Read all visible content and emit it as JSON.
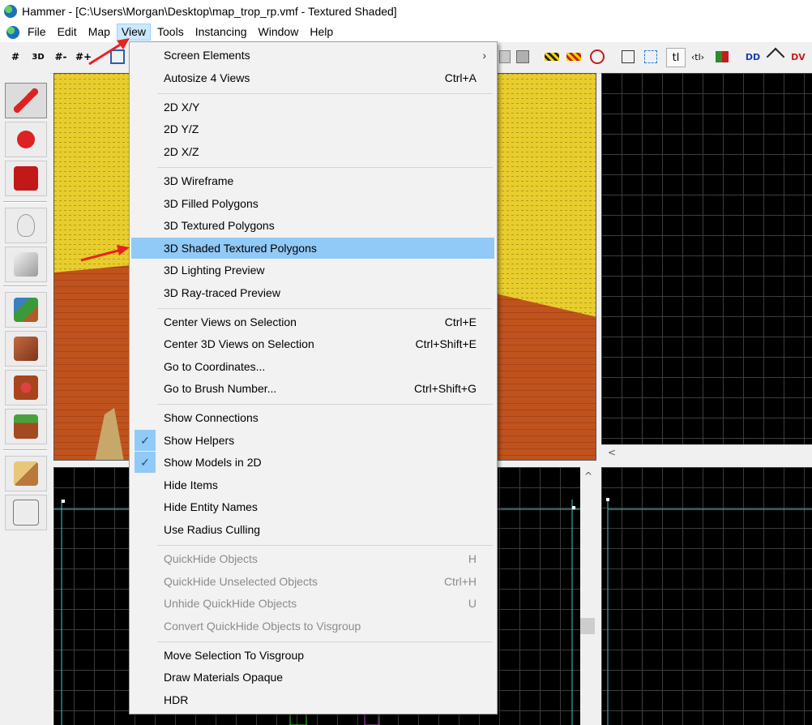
{
  "window": {
    "title": "Hammer - [C:\\Users\\Morgan\\Desktop\\map_trop_rp.vmf - Textured Shaded]"
  },
  "menubar": {
    "items": [
      "File",
      "Edit",
      "Map",
      "View",
      "Tools",
      "Instancing",
      "Window",
      "Help"
    ],
    "active": "View"
  },
  "toolbar": {
    "grid_label": "#",
    "grid3d_label": "3D",
    "grid_minus_label": "#-",
    "grid_plus_label": "#+",
    "texture_lock_label": "tl",
    "tl_arrows_label": "‹tl›",
    "dd_label": "DD",
    "dv_label": "DV"
  },
  "view_menu": {
    "items": [
      {
        "label": "Screen Elements",
        "shortcut": "",
        "submenu": true
      },
      {
        "label": "Autosize 4 Views",
        "shortcut": "Ctrl+A"
      },
      {
        "label": "2D X/Y",
        "shortcut": ""
      },
      {
        "label": "2D Y/Z",
        "shortcut": ""
      },
      {
        "label": "2D X/Z",
        "shortcut": ""
      },
      {
        "label": "3D Wireframe",
        "shortcut": ""
      },
      {
        "label": "3D Filled Polygons",
        "shortcut": ""
      },
      {
        "label": "3D Textured Polygons",
        "shortcut": ""
      },
      {
        "label": "3D Shaded Textured Polygons",
        "shortcut": "",
        "highlighted": true
      },
      {
        "label": "3D Lighting Preview",
        "shortcut": ""
      },
      {
        "label": "3D Ray-traced Preview",
        "shortcut": ""
      },
      {
        "label": "Center Views on Selection",
        "shortcut": "Ctrl+E"
      },
      {
        "label": "Center 3D Views on Selection",
        "shortcut": "Ctrl+Shift+E"
      },
      {
        "label": "Go to Coordinates...",
        "shortcut": ""
      },
      {
        "label": "Go to Brush Number...",
        "shortcut": "Ctrl+Shift+G"
      },
      {
        "label": "Show Connections",
        "shortcut": ""
      },
      {
        "label": "Show Helpers",
        "shortcut": "",
        "checked": true
      },
      {
        "label": "Show Models in 2D",
        "shortcut": "",
        "checked": true
      },
      {
        "label": "Hide Items",
        "shortcut": ""
      },
      {
        "label": "Hide Entity Names",
        "shortcut": ""
      },
      {
        "label": "Use Radius Culling",
        "shortcut": ""
      },
      {
        "label": "QuickHide Objects",
        "shortcut": "H",
        "disabled": true
      },
      {
        "label": "QuickHide Unselected Objects",
        "shortcut": "Ctrl+H",
        "disabled": true
      },
      {
        "label": "Unhide QuickHide Objects",
        "shortcut": "U",
        "disabled": true
      },
      {
        "label": "Convert QuickHide Objects to Visgroup",
        "shortcut": "",
        "disabled": true
      },
      {
        "label": "Move Selection To Visgroup",
        "shortcut": ""
      },
      {
        "label": "Draw Materials Opaque",
        "shortcut": ""
      },
      {
        "label": "HDR",
        "shortcut": ""
      }
    ]
  },
  "colors": {
    "menu_highlight": "#91c9f7",
    "annotation_arrow": "#e8231f",
    "wall_yellow": "#e8cd2e",
    "floor_orange": "#c4501a"
  }
}
